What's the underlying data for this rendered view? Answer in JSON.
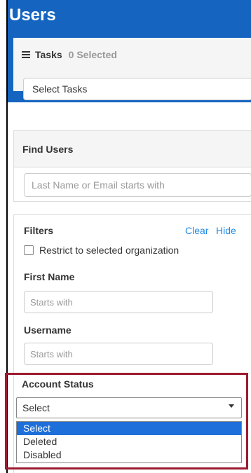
{
  "header": {
    "title": "Users",
    "tasks_label": "Tasks",
    "tasks_count": "0 Selected",
    "tasks_select": "Select Tasks"
  },
  "find_users": {
    "title": "Find Users",
    "placeholder": "Last Name or Email starts with"
  },
  "filters": {
    "title": "Filters",
    "clear_label": "Clear",
    "hide_label": "Hide",
    "restrict_label": "Restrict to selected organization",
    "first_name_label": "First Name",
    "first_name_placeholder": "Starts with",
    "username_label": "Username",
    "username_placeholder": "Starts with",
    "account_status_label": "Account Status",
    "account_status_value": "Select",
    "account_status_options": [
      "Select",
      "Deleted",
      "Disabled"
    ]
  },
  "colors": {
    "header_bg": "#1565c0",
    "link": "#1e88e5",
    "highlight_border": "#9b1b30",
    "option_selected": "#1e6fd9"
  },
  "icons": {
    "tasks": "list-icon",
    "dropdown": "caret-down-icon"
  }
}
